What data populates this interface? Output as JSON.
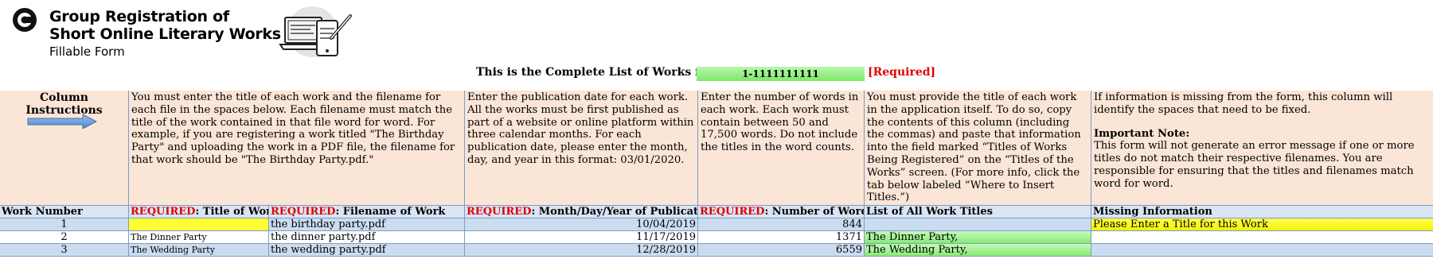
{
  "header": {
    "title_line1": "Group Registration of",
    "title_line2": "Short Online Literary Works",
    "subtitle": "Fillable Form",
    "complete_list_label": "This is the Complete List of Works for:",
    "complete_list_value": "1-1111111111",
    "required_tag": "[Required]"
  },
  "instructions": {
    "label": "Column Instructions",
    "title_filename": "You must enter the title of each work and the filename for each file in the spaces below. Each filename must match the title of the work contained in that file word for word. For example, if you are registering a work titled \"The Birthday Party\" and uploading the work in a PDF file, the filename for that work should be \"The Birthday Party.pdf.\"",
    "publication": "Enter the publication date for each work. All the works must be first published as part of a website or online platform within three calendar months. For each publication date, please enter the month, day, and year in this format: 03/01/2020.",
    "words": "Enter the number of words in each work. Each work must contain between 50 and 17,500 words. Do not include the titles in the word counts.",
    "titles": "You must provide the title of each work in the application itself. To do so, copy the contents of this column (including the commas) and paste that information into the field marked “Titles of Works Being Registered” on the “Titles of the Works” screen. (For more info, click the tab below labeled “Where to Insert Titles.”)",
    "missing_line1": "If information is missing from the form, this column will identify the spaces that need to be fixed.",
    "missing_note_head": "Important Note:",
    "missing_note": "This form will not generate an error message if one or more titles do not match their respective filenames. You are responsible for ensuring that the titles and filenames match word for word."
  },
  "columns": {
    "work_number": "Work Number",
    "required": "REQUIRED",
    "title": ": Title of Work",
    "filename": ": Filename of Work",
    "date": ": Month/Day/Year of Publication",
    "words": ": Number of Words",
    "list": "List of All Work Titles",
    "missing": "Missing Information"
  },
  "rows": [
    {
      "num": "1",
      "title": "",
      "filename": "the birthday party.pdf",
      "date": "10/04/2019",
      "words": "844",
      "list": "",
      "missing": "Please Enter a Title for this Work"
    },
    {
      "num": "2",
      "title": "The Dinner Party",
      "filename": "the dinner party.pdf",
      "date": "11/17/2019",
      "words": "1371",
      "list": "The Dinner Party,",
      "missing": ""
    },
    {
      "num": "3",
      "title": "The Wedding Party",
      "filename": "the wedding party.pdf",
      "date": "12/28/2019",
      "words": "6559",
      "list": "The Wedding Party,",
      "missing": ""
    }
  ],
  "icons": {
    "logo": "copyright-office-logo",
    "hero": "laptop-tablet-stylus-icon",
    "arrow": "arrow-right-icon"
  },
  "colors": {
    "instruction_bg": "#fbe5d6",
    "header_bg": "#d9e5f4",
    "row_alt_bg": "#ccdcf0",
    "required_red": "#e00000",
    "missing_yellow": "#ffff33",
    "valid_green": "#86ec72"
  }
}
